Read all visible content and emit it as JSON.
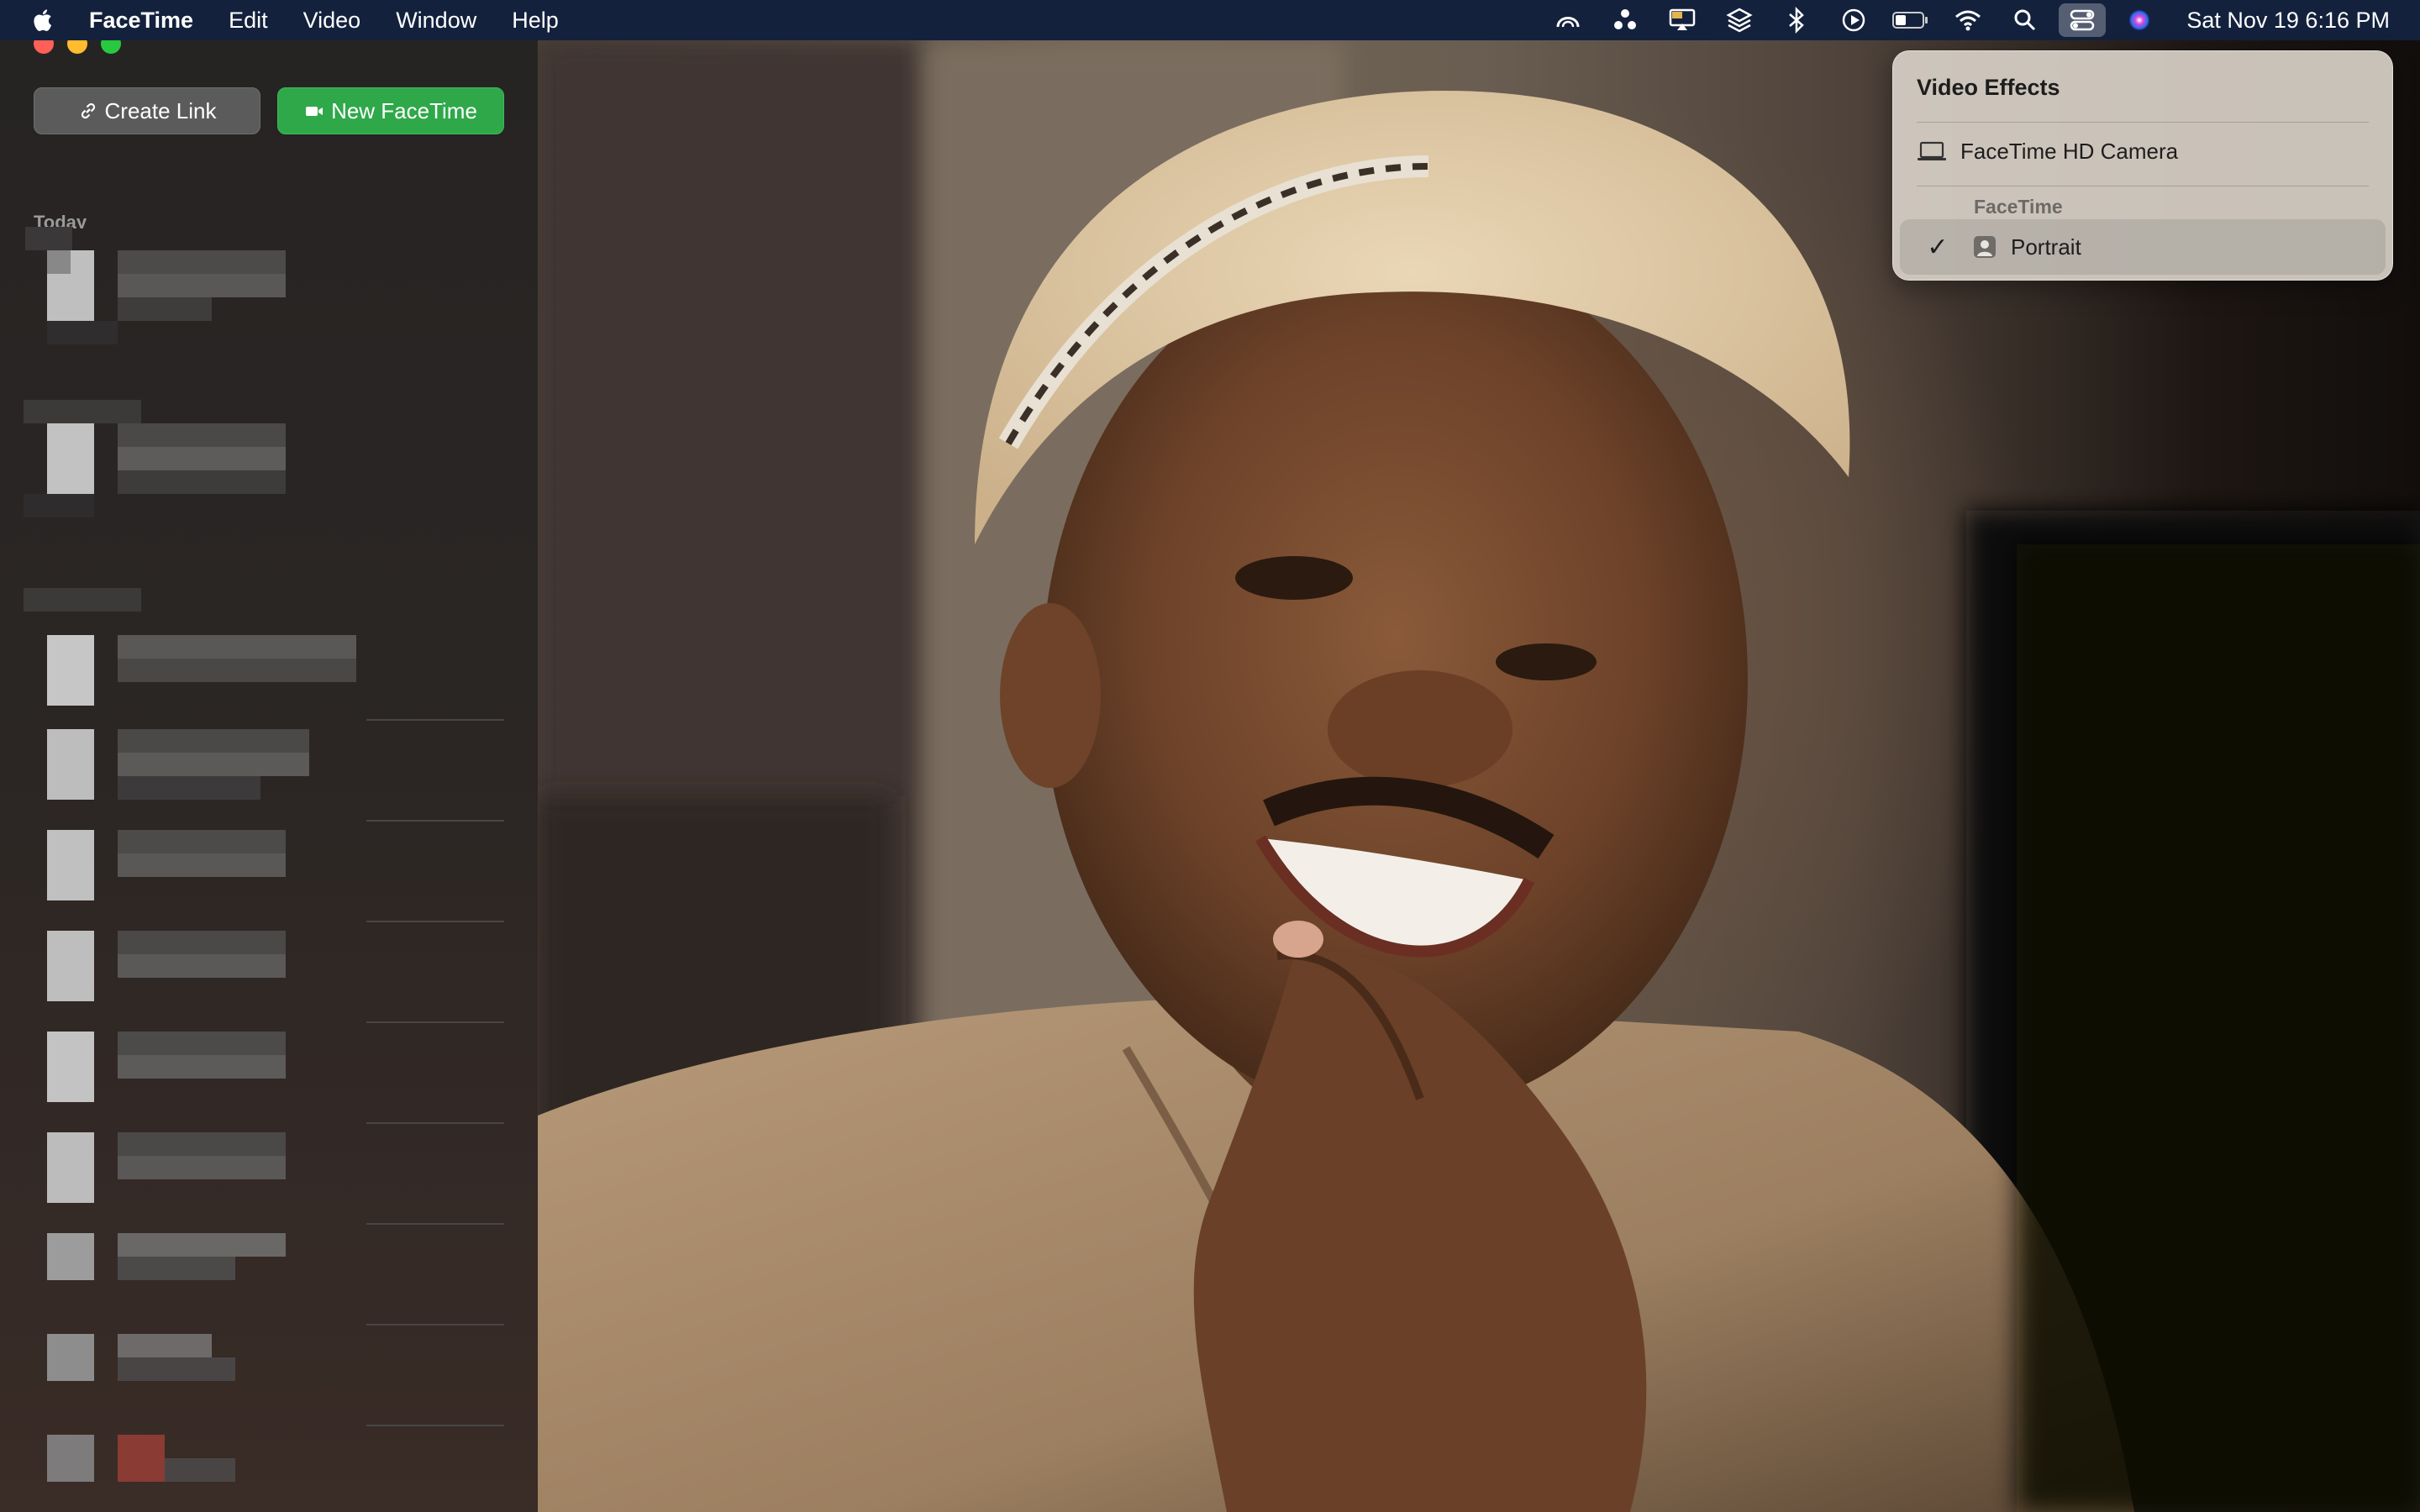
{
  "menubar": {
    "app_name": "FaceTime",
    "menus": [
      "Edit",
      "Video",
      "Window",
      "Help"
    ],
    "status_icons": [
      "creative-cloud-icon",
      "transmit-icon",
      "airplay-display-icon",
      "layers-icon",
      "bluetooth-icon",
      "play-circle-icon",
      "battery-icon",
      "wifi-icon",
      "spotlight-search-icon",
      "control-center-icon",
      "siri-icon"
    ],
    "clock": "Sat Nov 19  6:16 PM"
  },
  "sidebar": {
    "create_link_label": "Create Link",
    "new_facetime_label": "New FaceTime",
    "section_label": "Today"
  },
  "video_effects": {
    "title": "Video Effects",
    "camera": "FaceTime HD Camera",
    "group": "FaceTime",
    "effect": "Portrait",
    "effect_selected": true
  },
  "colors": {
    "menubar_bg": "#14213d",
    "new_facetime_green": "#2fa84a",
    "create_link_gray": "#5b5b5b"
  }
}
